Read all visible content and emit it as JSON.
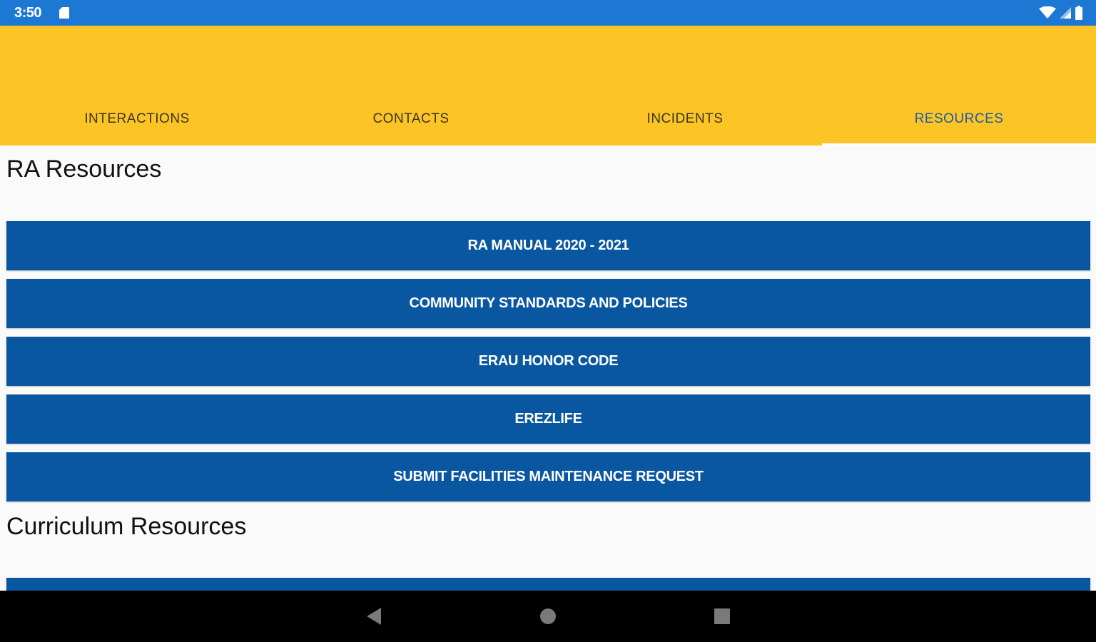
{
  "status_bar": {
    "time": "3:50",
    "icons": [
      "sd-card-icon",
      "wifi-icon",
      "cell-signal-icon",
      "battery-icon"
    ]
  },
  "tabs": [
    {
      "label": "INTERACTIONS",
      "active": false
    },
    {
      "label": "CONTACTS",
      "active": false
    },
    {
      "label": "INCIDENTS",
      "active": false
    },
    {
      "label": "RESOURCES",
      "active": true
    }
  ],
  "ra_section": {
    "title": "RA Resources",
    "buttons": [
      "RA MANUAL 2020 - 2021",
      "COMMUNITY STANDARDS AND POLICIES",
      "ERAU HONOR CODE",
      "EREZLIFE",
      "SUBMIT FACILITIES MAINTENANCE REQUEST"
    ]
  },
  "curriculum_section": {
    "title": "Curriculum Resources"
  },
  "nav_bar": {
    "icons": [
      "back-icon",
      "home-icon",
      "recents-icon"
    ]
  },
  "colors": {
    "status_bar": "#1c78d2",
    "app_bar": "#fdc425",
    "button": "#0a57a1",
    "active_tab_text": "#1a5da5",
    "background": "#fafafa"
  }
}
